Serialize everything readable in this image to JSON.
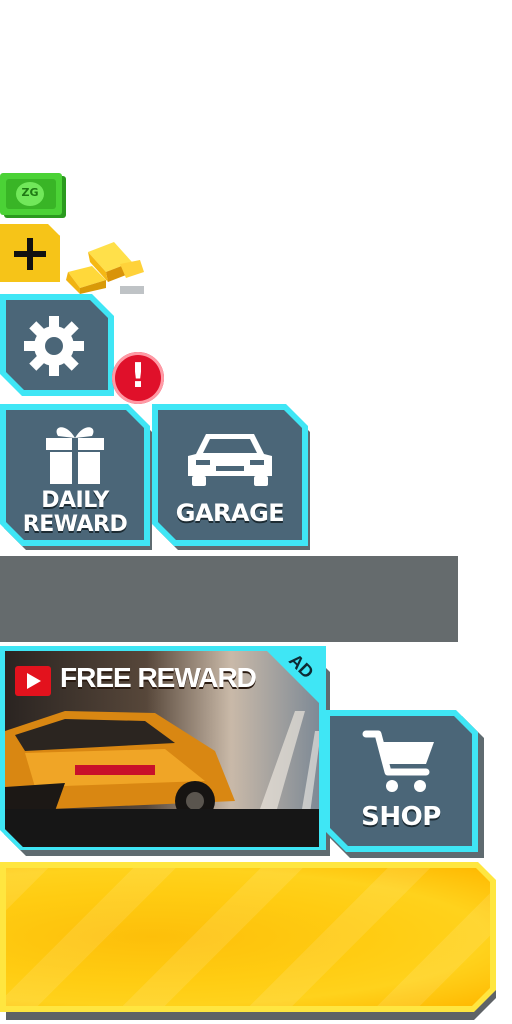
{
  "currency": {
    "cash_icon_label": "ZG",
    "add_button_icon": "plus-icon",
    "gold_icon": "gold-bars-icon"
  },
  "settings": {
    "icon": "gear-icon",
    "alert_icon": "exclamation-icon",
    "alert_symbol": "!"
  },
  "daily_reward": {
    "line1": "DAILY",
    "line2": "REWARD",
    "icon": "gift-icon"
  },
  "garage": {
    "label": "GARAGE",
    "icon": "car-icon"
  },
  "free_reward": {
    "badge": "AD",
    "label": "FREE REWARD",
    "icon": "play-icon"
  },
  "shop": {
    "label": "SHOP",
    "icon": "cart-icon"
  },
  "colors": {
    "frame": "#3fe6f5",
    "tile_fill": "#4b6678",
    "cash_green": "#3fbf2a",
    "gold": "#f7c21a",
    "alert_red": "#e0102a"
  }
}
